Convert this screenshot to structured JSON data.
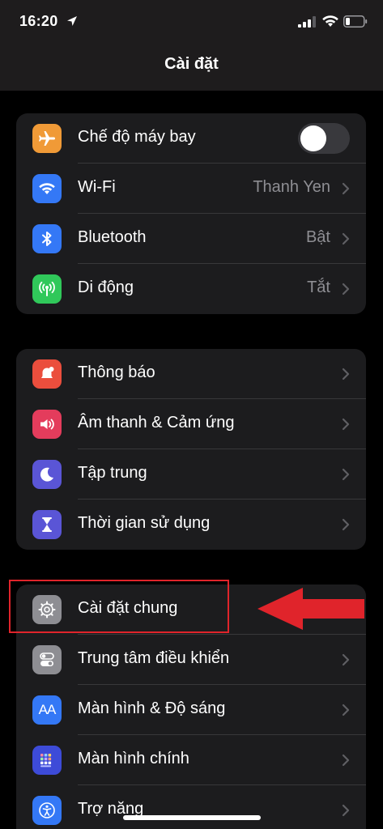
{
  "status_bar": {
    "time": "16:20"
  },
  "nav": {
    "title": "Cài đặt"
  },
  "groups": [
    {
      "items": [
        {
          "label": "Chế độ máy bay",
          "icon": "airplane-icon",
          "color": "#f09a37",
          "toggle": "off"
        },
        {
          "label": "Wi-Fi",
          "icon": "wifi-icon",
          "color": "#3478f6",
          "value": "Thanh Yen"
        },
        {
          "label": "Bluetooth",
          "icon": "bluetooth-icon",
          "color": "#3478f6",
          "value": "Bật"
        },
        {
          "label": "Di động",
          "icon": "antenna-icon",
          "color": "#30c85a",
          "value": "Tắt"
        }
      ]
    },
    {
      "items": [
        {
          "label": "Thông báo",
          "icon": "bell-icon",
          "color": "#eb4e3d"
        },
        {
          "label": "Âm thanh & Cảm ứng",
          "icon": "speaker-icon",
          "color": "#e43c5c"
        },
        {
          "label": "Tập trung",
          "icon": "moon-icon",
          "color": "#5a55d6"
        },
        {
          "label": "Thời gian sử dụng",
          "icon": "hourglass-icon",
          "color": "#5a55d6"
        }
      ]
    },
    {
      "items": [
        {
          "label": "Cài đặt chung",
          "icon": "gear-icon",
          "color": "#8e8e93"
        },
        {
          "label": "Trung tâm điều khiển",
          "icon": "toggles-icon",
          "color": "#8e8e93"
        },
        {
          "label": "Màn hình & Độ sáng",
          "icon": "text-size-icon",
          "color": "#3478f6",
          "icon_text": "AA"
        },
        {
          "label": "Màn hình chính",
          "icon": "home-grid-icon",
          "color": "#3d4bd8"
        },
        {
          "label": "Trợ năng",
          "icon": "accessibility-icon",
          "color": "#3478f6"
        }
      ]
    }
  ],
  "annotation": {
    "color": "#e0242b"
  }
}
